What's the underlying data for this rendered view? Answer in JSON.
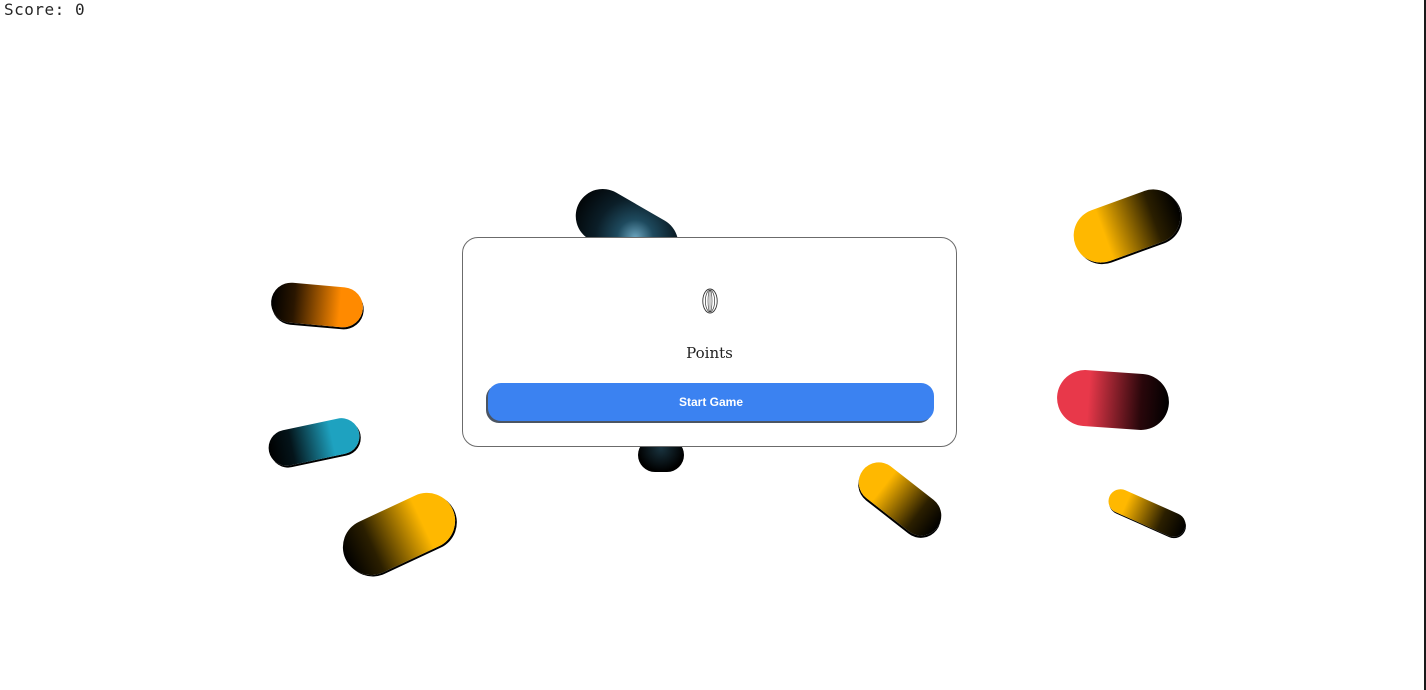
{
  "hud": {
    "score_label": "Score:",
    "score_value": "0"
  },
  "menu": {
    "coin_icon": "coin-icon",
    "points_label": "Points",
    "start_button_label": "Start Game",
    "button_color": "#3b82f1"
  },
  "balls": [
    {
      "name": "orange-ball-left",
      "color": "#ff8a00"
    },
    {
      "name": "teal-ball-left",
      "color": "#1ea2c0"
    },
    {
      "name": "yellow-ball-bottom-left",
      "color": "#ffb800"
    },
    {
      "name": "dark-blue-ball-top-center",
      "color": "#0e2733"
    },
    {
      "name": "yellow-ball-top-right",
      "color": "#ffb800"
    },
    {
      "name": "red-ball-right",
      "color": "#e8384a"
    },
    {
      "name": "yellow-ball-center-right",
      "color": "#ffb800"
    },
    {
      "name": "yellow-ball-small-right",
      "color": "#ffb800"
    }
  ]
}
